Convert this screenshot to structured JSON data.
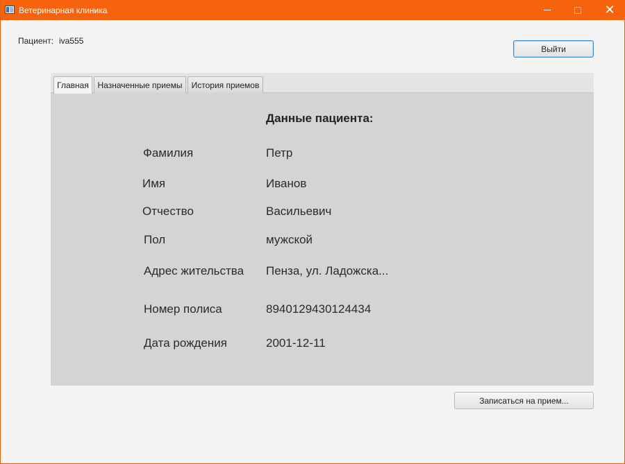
{
  "window": {
    "title": "Ветеринарная клиника",
    "accent_color": "#f7630c",
    "controls": {
      "minimize": "minimize-icon",
      "maximize": "maximize-icon",
      "close": "✕"
    }
  },
  "header": {
    "patient_label": "Пациент:",
    "patient_login": "iva555",
    "logout_label": "Выйти"
  },
  "tabs": [
    {
      "label": "Главная",
      "active": true
    },
    {
      "label": "Назначенные приемы",
      "active": false
    },
    {
      "label": "История приемов",
      "active": false
    }
  ],
  "patient": {
    "heading": "Данные пациента:",
    "fields": [
      {
        "label": "Фамилия",
        "value": "Петр"
      },
      {
        "label": "Имя",
        "value": "Иванов"
      },
      {
        "label": "Отчество",
        "value": "Васильевич"
      },
      {
        "label": "Пол",
        "value": "мужской"
      },
      {
        "label": "Адрес жительства",
        "value": "Пенза, ул. Ладожска..."
      },
      {
        "label": "Номер полиса",
        "value": "8940129430124434"
      },
      {
        "label": "Дата рождения",
        "value": "2001-12-11"
      }
    ]
  },
  "footer": {
    "appointment_label": "Записаться на прием..."
  }
}
